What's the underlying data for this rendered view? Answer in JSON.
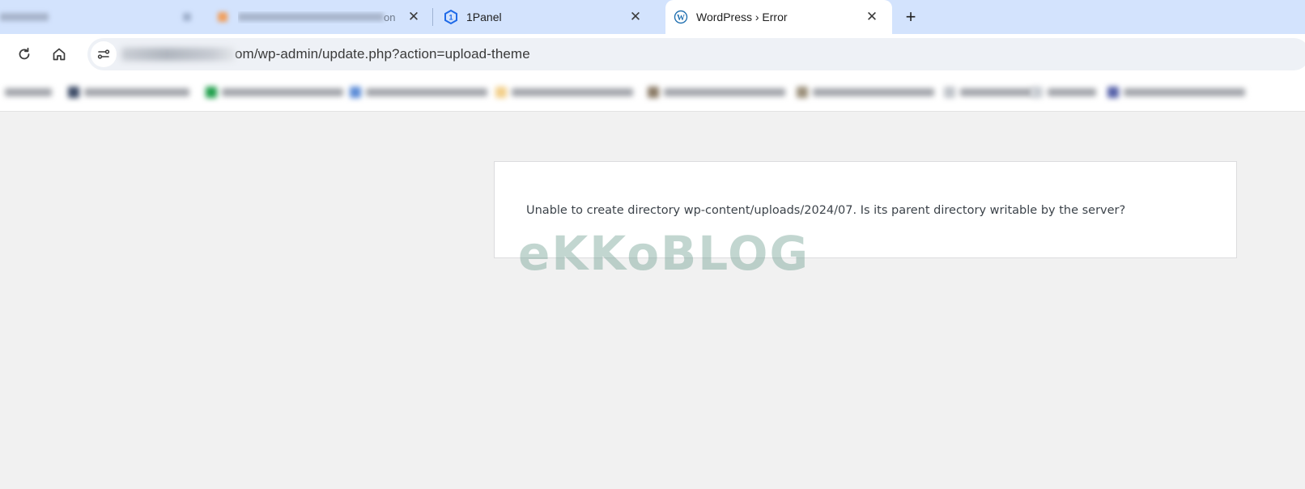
{
  "browser": {
    "tabs": [
      {
        "title": "",
        "blurred": true,
        "active": false
      },
      {
        "title": "",
        "blurred": true,
        "active": false,
        "suffix": "on"
      },
      {
        "title": "1Panel",
        "blurred": false,
        "active": false,
        "icon": "1panel-icon"
      },
      {
        "title": "WordPress › Error",
        "blurred": false,
        "active": true,
        "icon": "wordpress-icon"
      }
    ],
    "new_tab_label": "+",
    "close_label": "✕",
    "url_visible": "om/wp-admin/update.php?action=upload-theme"
  },
  "page": {
    "error_message": "Unable to create directory wp-content/uploads/2024/07. Is its parent directory writable by the server?",
    "watermark": "eKKoBLOG"
  },
  "colors": {
    "tabstrip_bg": "#d3e3fd",
    "page_bg": "#f1f1f1",
    "error_text": "#3c434a",
    "wordpress_blue": "#2271b1",
    "onepanel_blue": "#1f6ae8"
  }
}
